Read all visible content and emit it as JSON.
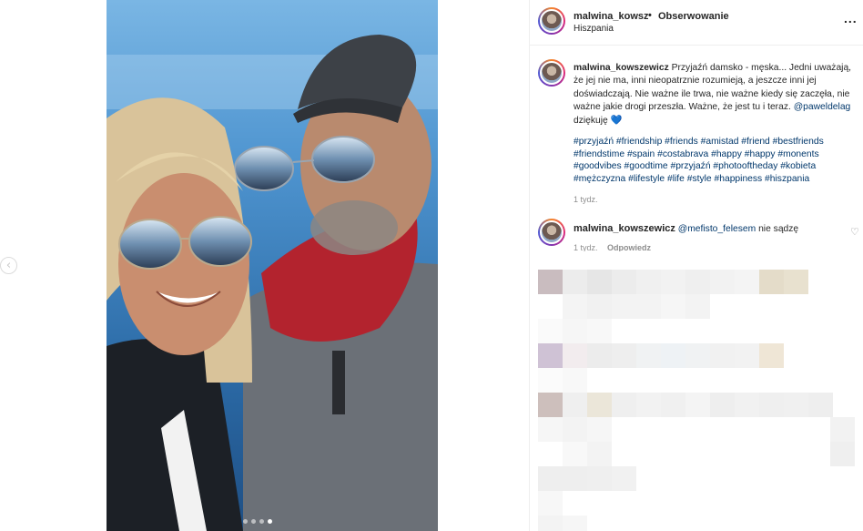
{
  "nav": {
    "prev_arrow": "‹"
  },
  "post": {
    "photo_alt": "",
    "carousel": {
      "count": 4,
      "active_index": 3
    }
  },
  "header": {
    "username": "malwina_kowszewicz",
    "separator": "•",
    "follow_label": "Obserwowanie",
    "location": "Hiszpania",
    "more_label": "..."
  },
  "caption": {
    "username": "malwina_kowszewicz",
    "text": "Przyjaźń damsko - męska... Jedni uważają, że jej nie ma, inni nieopatrznie rozumieją, a jeszcze inni jej doświadczają. Nie ważne ile trwa, nie ważne kiedy się zaczęła, nie ważne jakie drogi przeszła. Ważne, że jest tu i teraz.",
    "mention": "@paweldelag",
    "text_end": "dziękuję",
    "heart": "💙",
    "hashtags": "#przyjaźń #friendship #friends #amistad #friend #bestfriends #friendstime #spain #costabrava #happy #happy #monents #goodvibes #goodtime #przyjaźń #photooftheday #kobieta #mężczyzna #lifestyle #life #style #happiness #hiszpania",
    "time": "1 tydz."
  },
  "comments": [
    {
      "username": "malwina_kowszewicz",
      "mention": "@mefisto_felesem",
      "text": "nie sądzę",
      "time": "1 tydz.",
      "reply_label": "Odpowiedz"
    }
  ],
  "colors": {
    "link": "#00376b",
    "secondary_text": "#8e8e8e",
    "border": "#efefef"
  },
  "icons": {
    "like": "heart-outline-icon",
    "more": "ellipsis-icon",
    "prev": "chevron-left-icon"
  }
}
